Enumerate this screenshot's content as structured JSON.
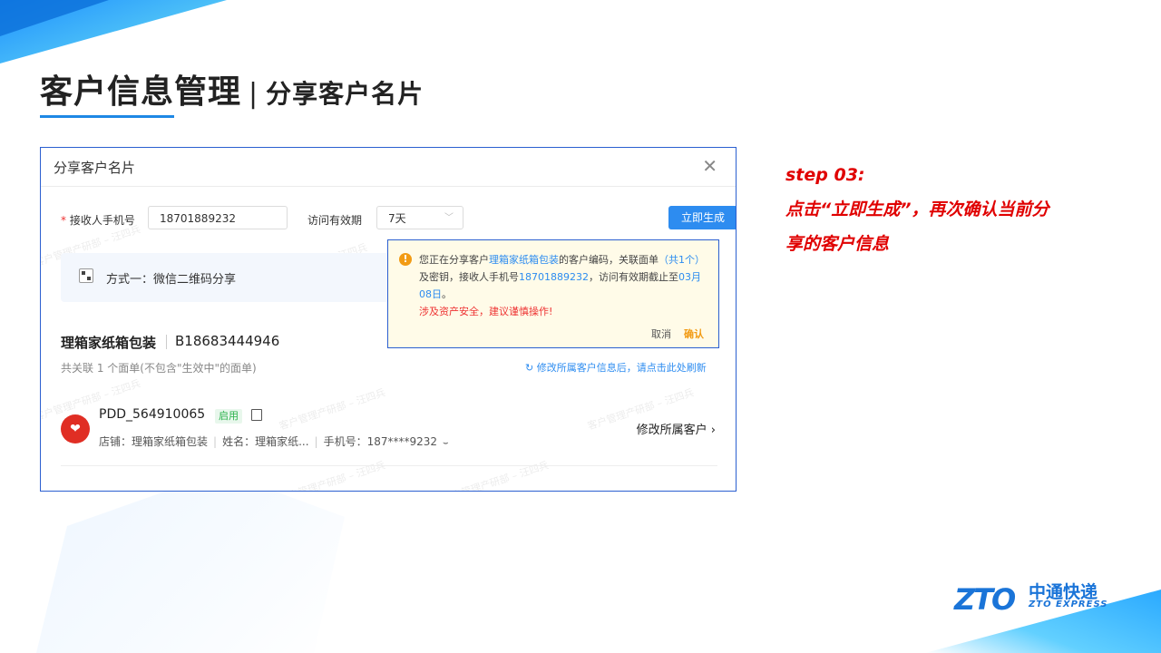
{
  "header": {
    "title": "客户信息管理",
    "separator": "|",
    "subtitle": "分享客户名片"
  },
  "dialog": {
    "title": "分享客户名片",
    "close_icon": "close-icon",
    "phone_label_required": "*",
    "phone_label": "接收人手机号",
    "phone_value": "18701889232",
    "validity_label": "访问有效期",
    "validity_value": "7天",
    "generate_button": "立即生成",
    "method_label": "方式一：微信二维码分享",
    "watermark": "客户管理产研部 – 汪四兵",
    "shop_name": "理箱家纸箱包装",
    "shop_code": "B18683444946",
    "assoc_text": "共关联 1 个面单(不包含\"生效中\"的面单)",
    "refresh_link": "修改所属客户信息后，请点击此处刷新",
    "store": {
      "id": "PDD_564910065",
      "status": "启用",
      "shop_field": "店铺：理箱家纸箱包装",
      "name_field": "姓名：理箱家纸...",
      "phone_field": "手机号：187****9232",
      "modify_link": "修改所属客户"
    }
  },
  "popconfirm": {
    "icon": "!",
    "t1": "您正在分享客户",
    "shop": "理箱家纸箱包装",
    "t2": "的客户编码，关联面单",
    "count": "（共1个）",
    "t3": "及密钥，接收人手机号",
    "phone": "18701889232",
    "t4": "，访问有效期截止至",
    "date": "03月08日",
    "t5": "。",
    "warning": "涉及资产安全，建议谨慎操作!",
    "cancel": "取消",
    "confirm": "确认"
  },
  "step": {
    "label": "step 03:",
    "line1": "点击“立即生成”，再次确认当前分",
    "line2": "享的客户信息"
  },
  "logo": {
    "mark": "ZTO",
    "cn": "中通快递",
    "en": "ZTO EXPRESS"
  },
  "colors": {
    "accent": "#2d8cf0",
    "warning": "#f29b14",
    "danger": "#e33333",
    "step_red": "#e00000"
  }
}
